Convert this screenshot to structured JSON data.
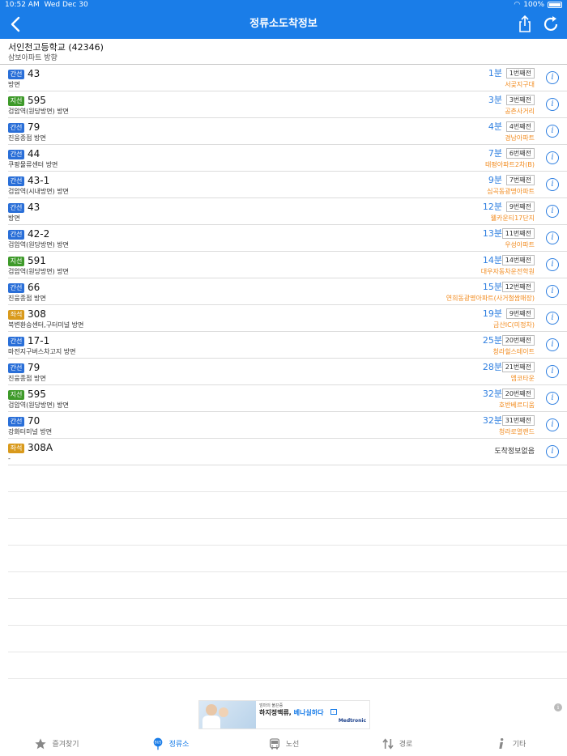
{
  "status": {
    "time": "10:52 AM",
    "date": "Wed Dec 30",
    "battery": "100%"
  },
  "nav": {
    "title": "정류소도착정보"
  },
  "stop": {
    "name": "서인천고등학교 (42346)",
    "direction": "삼보아파트 방향"
  },
  "rows": [
    {
      "type": "간선",
      "color": "blue",
      "number": "43",
      "direction": "방면",
      "minutes": "1분",
      "stops": "1번째전",
      "location": "서곶지구대"
    },
    {
      "type": "지선",
      "color": "green",
      "number": "595",
      "direction": "검암역(원당방면) 방면",
      "minutes": "3분",
      "stops": "3번째전",
      "location": "공촌사거리"
    },
    {
      "type": "간선",
      "color": "blue",
      "number": "79",
      "direction": "진웅종점 방면",
      "minutes": "4분",
      "stops": "4번째전",
      "location": "경남아파트"
    },
    {
      "type": "간선",
      "color": "blue",
      "number": "44",
      "direction": "쿠팡물류센터 방면",
      "minutes": "7분",
      "stops": "6번째전",
      "location": "태평아파트2차(B)"
    },
    {
      "type": "간선",
      "color": "blue",
      "number": "43-1",
      "direction": "검암역(시내방면) 방면",
      "minutes": "9분",
      "stops": "7번째전",
      "location": "심곡동광명아파트"
    },
    {
      "type": "간선",
      "color": "blue",
      "number": "43",
      "direction": "방면",
      "minutes": "12분",
      "stops": "9번째전",
      "location": "웰카운티17단지"
    },
    {
      "type": "간선",
      "color": "blue",
      "number": "42-2",
      "direction": "검암역(원당방면) 방면",
      "minutes": "13분",
      "stops": "11번째전",
      "location": "우성아파트"
    },
    {
      "type": "지선",
      "color": "green",
      "number": "591",
      "direction": "검암역(원당방면) 방면",
      "minutes": "14분",
      "stops": "14번째전",
      "location": "대우자동차운전학원"
    },
    {
      "type": "간선",
      "color": "blue",
      "number": "66",
      "direction": "진웅종점 방면",
      "minutes": "15분",
      "stops": "12번째전",
      "location": "연희동광명아파트(사거철쌈매장)"
    },
    {
      "type": "좌석",
      "color": "orange",
      "number": "308",
      "direction": "북변환승센터,구터미널 방면",
      "minutes": "19분",
      "stops": "9번째전",
      "location": "금산IC(미정차)"
    },
    {
      "type": "간선",
      "color": "blue",
      "number": "17-1",
      "direction": "마전지구버스차고지 방면",
      "minutes": "25분",
      "stops": "20번째전",
      "location": "청라힐스테이트"
    },
    {
      "type": "간선",
      "color": "blue",
      "number": "79",
      "direction": "진웅종점 방면",
      "minutes": "28분",
      "stops": "21번째전",
      "location": "엠코타운"
    },
    {
      "type": "지선",
      "color": "green",
      "number": "595",
      "direction": "검암역(원당방면) 방면",
      "minutes": "32분",
      "stops": "20번째전",
      "location": "호반베르디움"
    },
    {
      "type": "간선",
      "color": "blue",
      "number": "70",
      "direction": "강화터미널 방면",
      "minutes": "32분",
      "stops": "31번째전",
      "location": "청라로열랜드"
    }
  ],
  "last_row": {
    "type": "좌석",
    "color": "orange",
    "number": "308A",
    "direction": "-",
    "status": "도착정보없음"
  },
  "ad": {
    "line1": "엄마의 불끈증",
    "line2a": "하지정맥류, ",
    "line2b": "베나실하다",
    "line3": "",
    "brand": "Medtronic"
  },
  "tabs": [
    {
      "label": "즐겨찾기",
      "icon": "star-icon"
    },
    {
      "label": "정류소",
      "icon": "bus-stop-icon"
    },
    {
      "label": "노선",
      "icon": "bus-icon"
    },
    {
      "label": "경로",
      "icon": "route-arrows-icon"
    },
    {
      "label": "기타",
      "icon": "info-icon"
    }
  ],
  "colors": {
    "primary": "#1a7de8",
    "minutes": "#2f7fe0",
    "location": "#f28a1c"
  }
}
